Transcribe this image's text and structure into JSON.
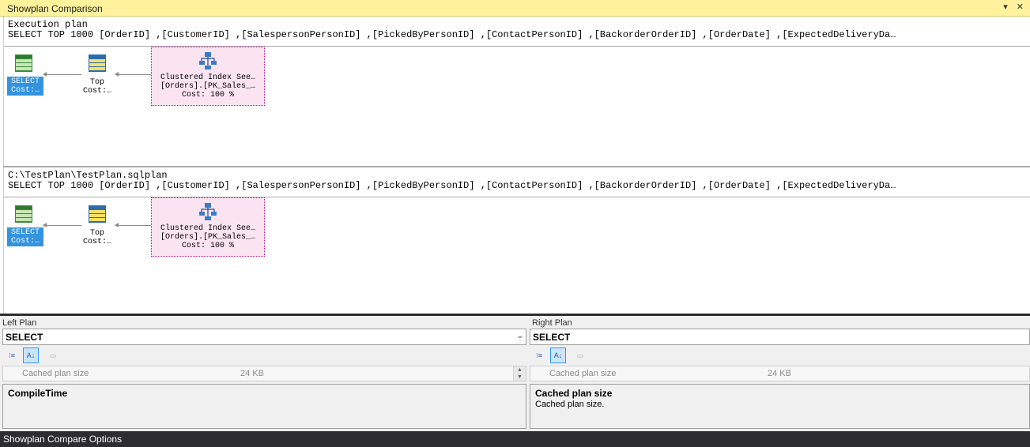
{
  "window": {
    "title": "Showplan Comparison",
    "pin_icon": "dropdown-pin-icon"
  },
  "top_plan": {
    "label": "Execution plan",
    "query": "SELECT TOP 1000 [OrderID] ,[CustomerID] ,[SalespersonPersonID] ,[PickedByPersonID] ,[ContactPersonID] ,[BackorderOrderID] ,[OrderDate] ,[ExpectedDeliveryDa…",
    "select_op": {
      "name": "SELECT",
      "cost": "Cost:…"
    },
    "top_op": {
      "name": "Top",
      "cost": "Cost:…"
    },
    "seek_op": {
      "name": "Clustered Index See…",
      "object": "[Orders].[PK_Sales_…",
      "cost": "Cost: 100 %"
    }
  },
  "bottom_plan": {
    "label": "C:\\TestPlan\\TestPlan.sqlplan",
    "query": "SELECT TOP 1000 [OrderID] ,[CustomerID] ,[SalespersonPersonID] ,[PickedByPersonID] ,[ContactPersonID] ,[BackorderOrderID] ,[OrderDate] ,[ExpectedDeliveryDa…",
    "select_op": {
      "name": "SELECT",
      "cost": "Cost:…"
    },
    "top_op": {
      "name": "Top",
      "cost": "Cost:…"
    },
    "seek_op": {
      "name": "Clustered Index See…",
      "object": "[Orders].[PK_Sales_…",
      "cost": "Cost: 100 %"
    }
  },
  "left_panel": {
    "label": "Left Plan",
    "selected": "SELECT",
    "property": {
      "key": "Cached plan size",
      "value": "24 KB"
    },
    "description_title": "CompileTime",
    "description_text": ""
  },
  "right_panel": {
    "label": "Right Plan",
    "selected": "SELECT",
    "property": {
      "key": "Cached plan size",
      "value": "24 KB"
    },
    "description_title": "Cached plan size",
    "description_text": "Cached plan size."
  },
  "status_bar": {
    "text": "Showplan Compare Options"
  },
  "colors": {
    "title_bar": "#fff29d",
    "selection": "#3393df",
    "seek_border": "#c0138e",
    "status_bar": "#2d2d30"
  }
}
